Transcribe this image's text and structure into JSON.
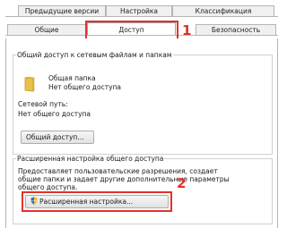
{
  "tabs": {
    "row1": [
      {
        "label": "Предыдущие версии"
      },
      {
        "label": "Настройка"
      },
      {
        "label": "Классификация"
      }
    ],
    "row2": [
      {
        "label": "Общие"
      },
      {
        "label": "Доступ"
      },
      {
        "label": "Безопасность"
      }
    ],
    "active": "Доступ"
  },
  "markers": {
    "one": "1",
    "two": "2"
  },
  "sharing": {
    "title": "Общий доступ к сетевым файлам и папкам",
    "folder_name": "Общая папка",
    "folder_status": "Нет общего доступа",
    "network_path_label": "Сетевой путь:",
    "network_path_value": "Нет общего доступа",
    "share_button": "Общий доступ..."
  },
  "advanced": {
    "title": "Расширенная настройка общего доступа",
    "desc_line1": "Предоставляет пользовательские разрешения, создает",
    "desc_line2": "общие папки и задает другие дополнительные параметры",
    "desc_line3": "общего доступа.",
    "button": "Расширенная настройка..."
  },
  "colors": {
    "highlight": "#e0322a",
    "folder": "#e8c14a"
  },
  "icons": {
    "folder": "folder-icon",
    "shield": "uac-shield-icon"
  }
}
